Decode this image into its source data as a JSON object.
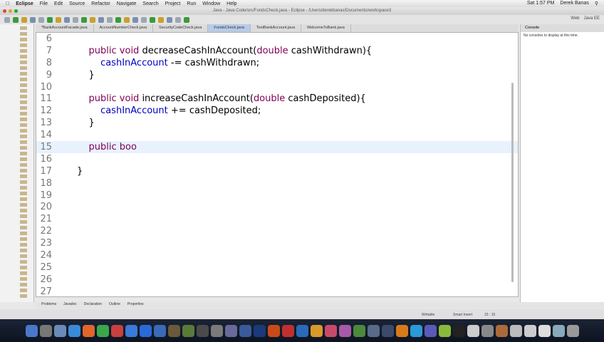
{
  "menubar": {
    "app": "Eclipse",
    "items": [
      "File",
      "Edit",
      "Source",
      "Refactor",
      "Navigate",
      "Search",
      "Project",
      "Run",
      "Window",
      "Help"
    ],
    "clock": "Sat 1:57 PM",
    "user": "Derek Banas"
  },
  "window_title": "Java - Java Code/src/FundsCheck.java - Eclipse - /Users/derekbanas/Documents/workspace3",
  "perspectives": [
    "Web",
    "Java EE"
  ],
  "editor_tabs": [
    "*BankAccountFacade.java",
    "AccountNumberCheck.java",
    "SecurityCodeCheck.java",
    "FundsCheck.java",
    "TestBankAccount.java",
    "WelcomeToBank.java"
  ],
  "active_tab": 3,
  "code_lines": [
    {
      "n": "6",
      "t": ""
    },
    {
      "n": "7",
      "t": "    public void decreaseCashInAccount(double cashWithdrawn){"
    },
    {
      "n": "8",
      "t": "        cashInAccount -= cashWithdrawn;"
    },
    {
      "n": "9",
      "t": "    }"
    },
    {
      "n": "10",
      "t": ""
    },
    {
      "n": "11",
      "t": "    public void increaseCashInAccount(double cashDeposited){"
    },
    {
      "n": "12",
      "t": "        cashInAccount += cashDeposited;"
    },
    {
      "n": "13",
      "t": "    }"
    },
    {
      "n": "14",
      "t": ""
    },
    {
      "n": "15",
      "t": "    public boo"
    },
    {
      "n": "16",
      "t": ""
    },
    {
      "n": "17",
      "t": "}"
    },
    {
      "n": "18",
      "t": ""
    },
    {
      "n": "19",
      "t": ""
    },
    {
      "n": "20",
      "t": ""
    },
    {
      "n": "21",
      "t": ""
    },
    {
      "n": "22",
      "t": ""
    },
    {
      "n": "23",
      "t": ""
    },
    {
      "n": "24",
      "t": ""
    },
    {
      "n": "25",
      "t": ""
    },
    {
      "n": "26",
      "t": ""
    },
    {
      "n": "27",
      "t": ""
    }
  ],
  "current_line": "15",
  "console": {
    "title": "Console",
    "message": "No consoles to display at this time."
  },
  "bottom_tabs": [
    "Problems",
    "Javadoc",
    "Declaration",
    "Outline",
    "Properties"
  ],
  "status": {
    "mode": "Writable",
    "insert": "Smart Insert",
    "position": "15 : 15"
  }
}
